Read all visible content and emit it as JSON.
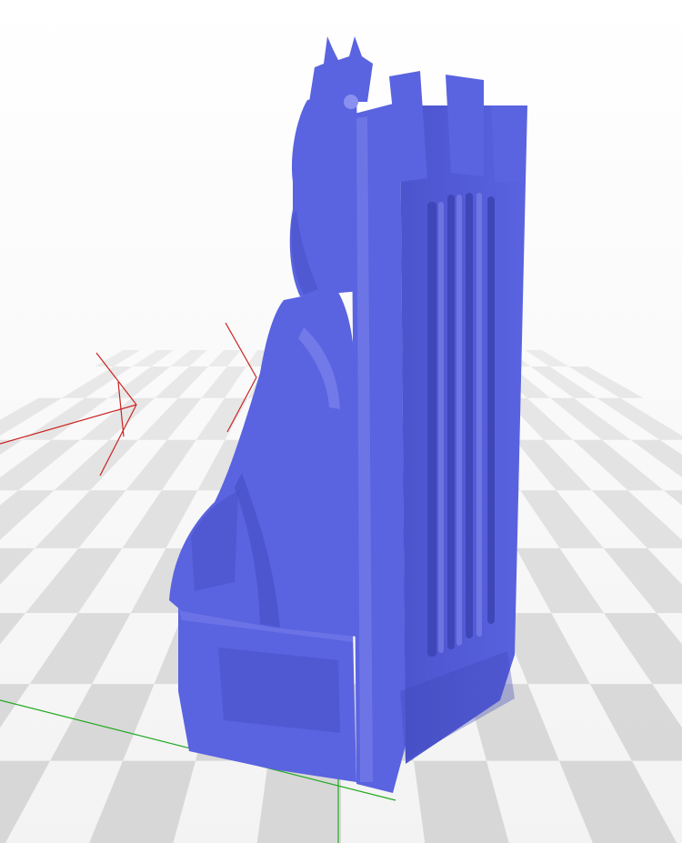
{
  "viewport": {
    "background_top": "#ffffff",
    "background_horizon": "#f0f0f0",
    "grid_light": "#e4e4e4",
    "grid_dark": "#cfcfcf"
  },
  "axes": {
    "x_color": "#cc2222",
    "y_color": "#22aa22",
    "z_color": "#22aa22"
  },
  "model": {
    "subject": "chess-king-on-throne",
    "color": "#5a63e0",
    "shade": "#3f47b8",
    "highlight": "#8a90f0"
  }
}
